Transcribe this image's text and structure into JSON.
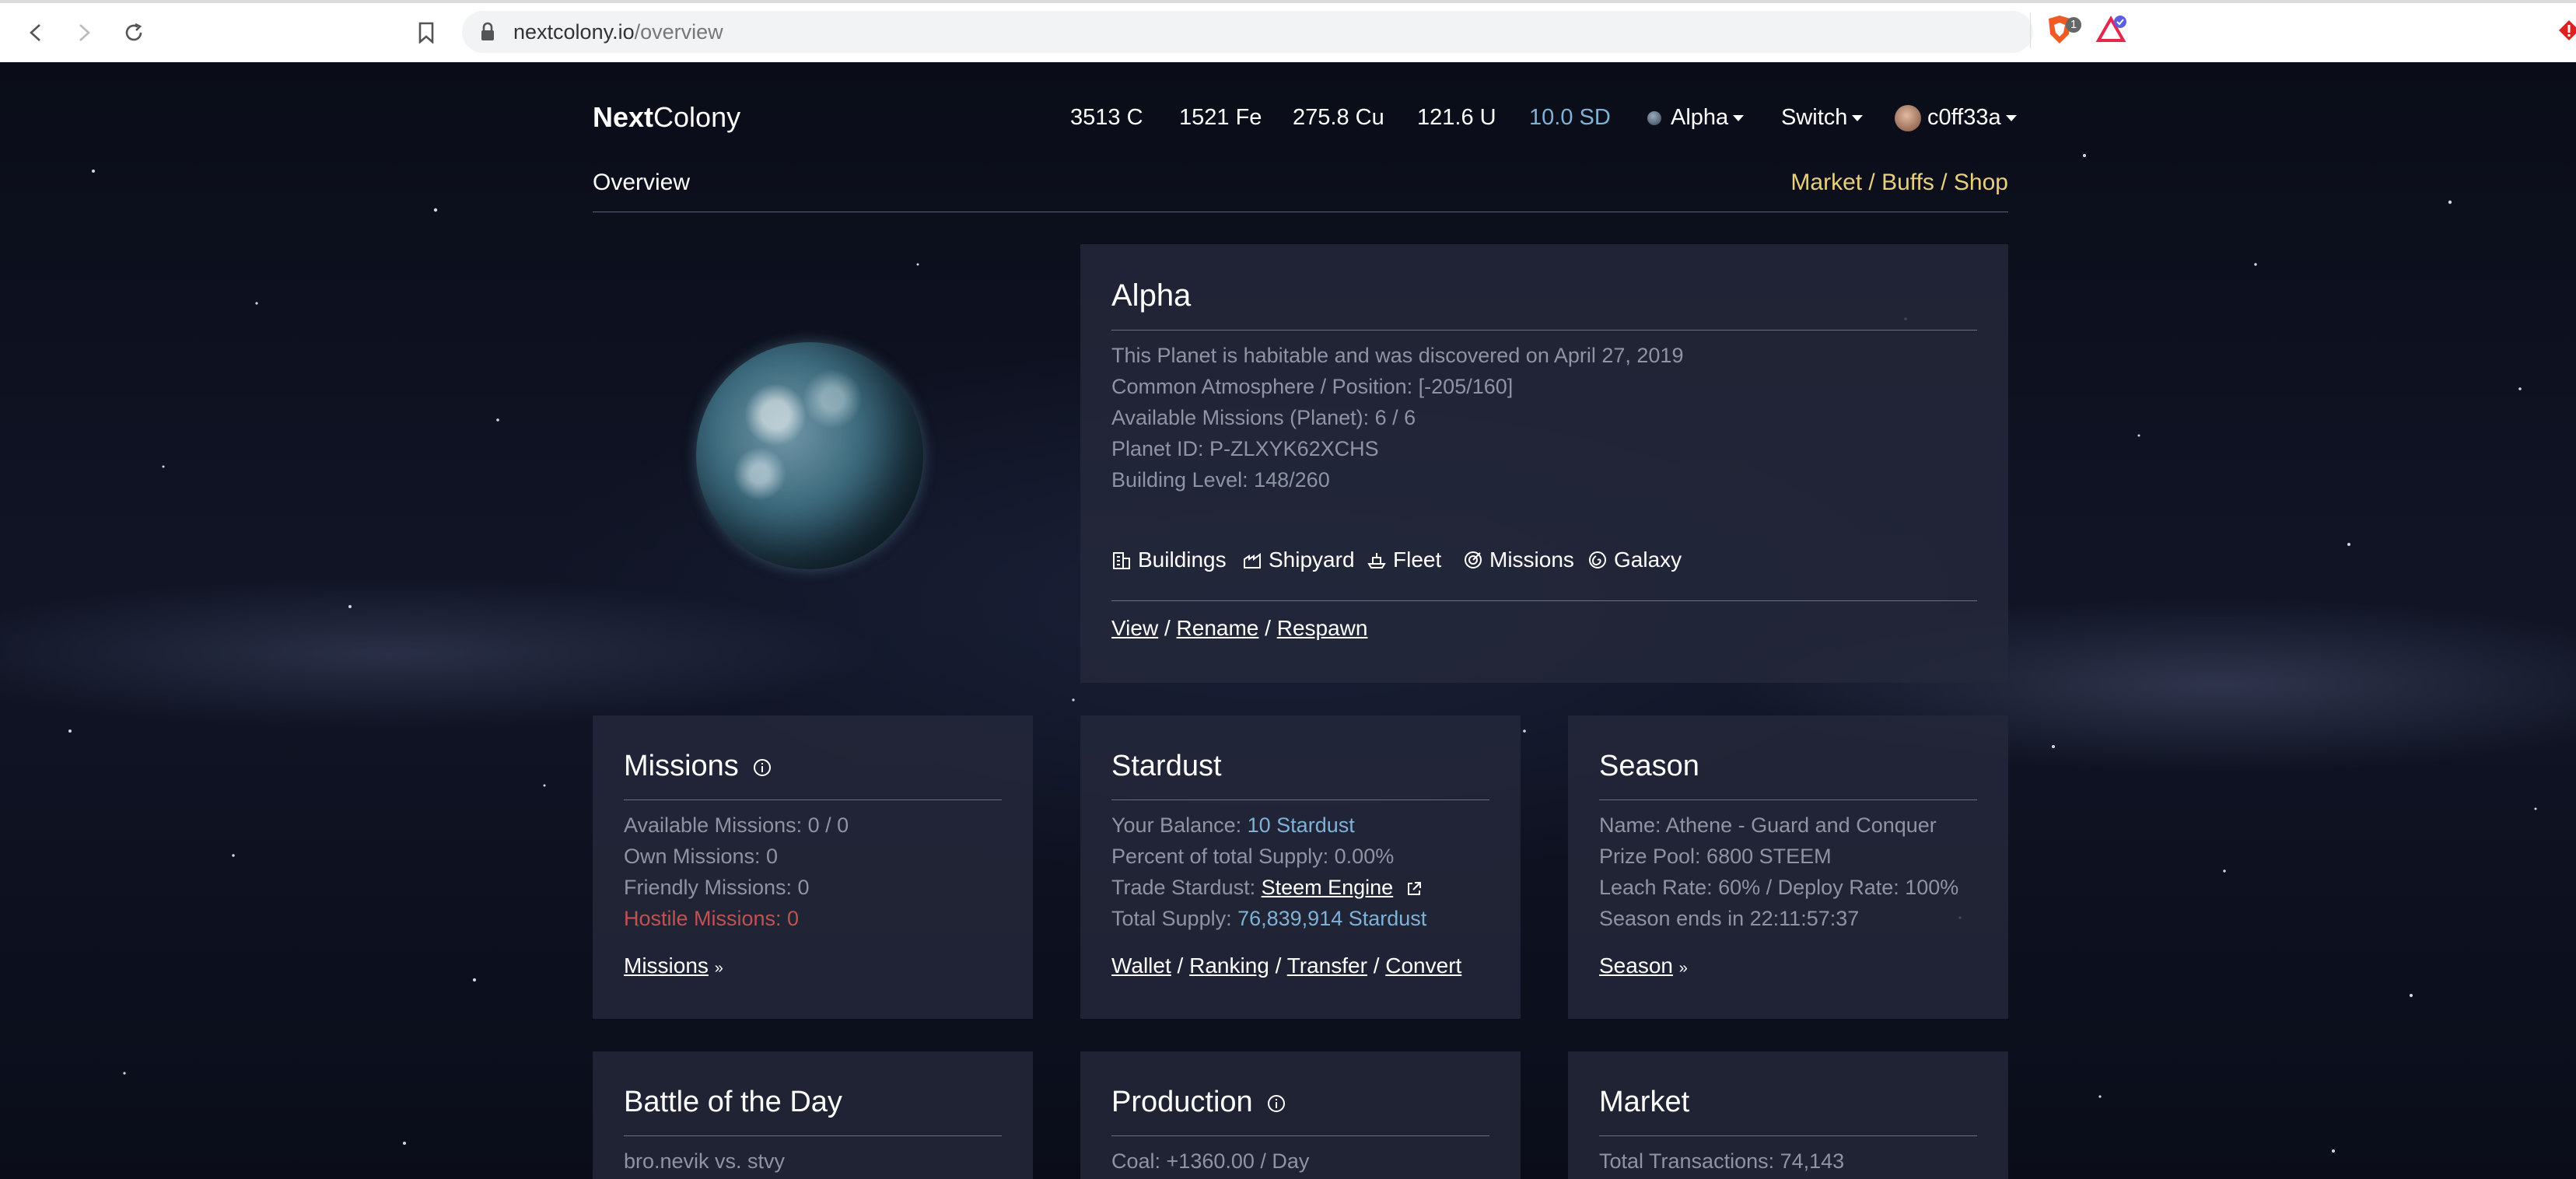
{
  "browser": {
    "url_host": "nextcolony.io",
    "url_path": "/overview",
    "brave_badge": "1"
  },
  "header": {
    "brand_bold": "Next",
    "brand_light": "Colony",
    "resources": {
      "coal": "3513 C",
      "ore": "1521 Fe",
      "copper": "275.8 Cu",
      "uranium": "121.6 U",
      "stardust": "10.0 SD"
    },
    "planet_select": "Alpha",
    "switch_label": "Switch",
    "user_label": "c0ff33a"
  },
  "subheader": {
    "title": "Overview",
    "links": "Market / Buffs / Shop"
  },
  "planet": {
    "name": "Alpha",
    "info": [
      "This Planet is habitable and was discovered on April 27, 2019",
      "Common Atmosphere / Position: [-205/160]",
      "Available Missions (Planet): 6 / 6",
      "Planet ID: P-ZLXYK62XCHS",
      "Building Level: 148/260"
    ],
    "nav": {
      "buildings": "Buildings",
      "shipyard": "Shipyard",
      "fleet": "Fleet",
      "missions": "Missions",
      "galaxy": "Galaxy"
    },
    "actions": {
      "view": "View",
      "rename": "Rename",
      "respawn": "Respawn",
      "sep": "/"
    }
  },
  "missions_panel": {
    "title": "Missions",
    "available": "Available Missions: 0 / 0",
    "own": "Own Missions: 0",
    "friendly": "Friendly Missions: 0",
    "hostile": "Hostile Missions: 0",
    "link": "Missions",
    "link_suffix": "»"
  },
  "stardust_panel": {
    "title": "Stardust",
    "balance_label": "Your Balance: ",
    "balance_value": "10 Stardust",
    "percent": "Percent of total Supply: 0.00%",
    "trade_label": "Trade Stardust: ",
    "trade_link": "Steem Engine",
    "supply_label": "Total Supply: ",
    "supply_value": "76,839,914 Stardust",
    "links": {
      "wallet": "Wallet",
      "ranking": "Ranking",
      "transfer": "Transfer",
      "convert": "Convert"
    }
  },
  "season_panel": {
    "title": "Season",
    "name": "Name: Athene - Guard and Conquer",
    "prize": "Prize Pool: 6800 STEEM",
    "rates": "Leach Rate: 60% / Deploy Rate: 100%",
    "ends": "Season ends in 22:11:57:37",
    "link": "Season",
    "link_suffix": "»"
  },
  "battle_panel": {
    "title": "Battle of the Day",
    "line1": "bro.nevik vs. stvy"
  },
  "production_panel": {
    "title": "Production",
    "line1": "Coal: +1360.00 / Day"
  },
  "market_panel": {
    "title": "Market",
    "line1": "Total Transactions: 74,143"
  }
}
